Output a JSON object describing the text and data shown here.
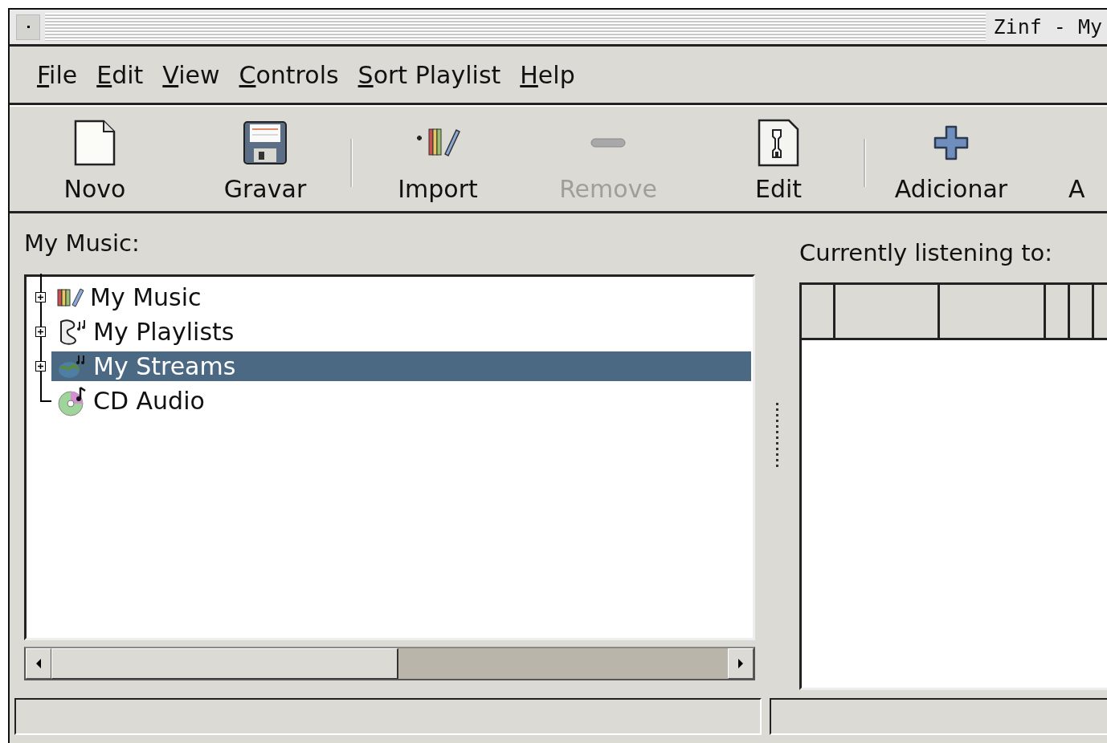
{
  "window": {
    "title": "Zinf - My"
  },
  "menu": [
    {
      "label": "File"
    },
    {
      "label": "Edit"
    },
    {
      "label": "View"
    },
    {
      "label": "Controls"
    },
    {
      "label": "Sort Playlist"
    },
    {
      "label": "Help"
    }
  ],
  "toolbar": [
    {
      "kind": "button",
      "label": "Novo",
      "disabled": false
    },
    {
      "kind": "button",
      "label": "Gravar",
      "disabled": false
    },
    {
      "kind": "separator"
    },
    {
      "kind": "button",
      "label": "Import",
      "disabled": false
    },
    {
      "kind": "button",
      "label": "Remove",
      "disabled": true
    },
    {
      "kind": "button",
      "label": "Edit",
      "disabled": false
    },
    {
      "kind": "separator"
    },
    {
      "kind": "button",
      "label": "Adicionar",
      "disabled": false
    },
    {
      "kind": "button",
      "label": "A",
      "disabled": false
    }
  ],
  "library": {
    "label": "My Music:",
    "tree": [
      {
        "label": "My Music",
        "expandable": true,
        "selected": false
      },
      {
        "label": "My Playlists",
        "expandable": true,
        "selected": false
      },
      {
        "label": "My Streams",
        "expandable": true,
        "selected": true
      },
      {
        "label": "CD Audio",
        "expandable": false,
        "selected": false
      }
    ]
  },
  "playlist": {
    "label": "Currently listening to:"
  }
}
